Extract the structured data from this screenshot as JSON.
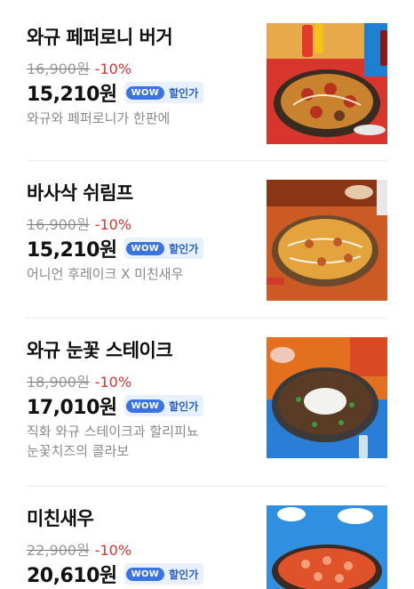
{
  "wow": {
    "badge": "WOW",
    "label": "할인가"
  },
  "items": [
    {
      "name": "와규 페퍼로니 버거",
      "original_price": "16,900원",
      "discount": "-10%",
      "sale_price": "15,210원",
      "description": [
        "와규와 페퍼로니가 한판에"
      ],
      "image": "pizza-pepperoni-burger-photo"
    },
    {
      "name": "바사삭 쉬림프",
      "original_price": "16,900원",
      "discount": "-10%",
      "sale_price": "15,210원",
      "description": [
        "어니언 후레이크 X 미친새우"
      ],
      "image": "pizza-shrimp-photo"
    },
    {
      "name": "와규 눈꽃 스테이크",
      "original_price": "18,900원",
      "discount": "-10%",
      "sale_price": "17,010원",
      "description": [
        "직화 와규 스테이크과 할리피뇨",
        "눈꽃치즈의 콜라보"
      ],
      "image": "pizza-steak-snow-cheese-photo"
    },
    {
      "name": "미친새우",
      "original_price": "22,900원",
      "discount": "-10%",
      "sale_price": "20,610원",
      "description": [],
      "image": "pizza-shrimp-blue-photo"
    }
  ]
}
